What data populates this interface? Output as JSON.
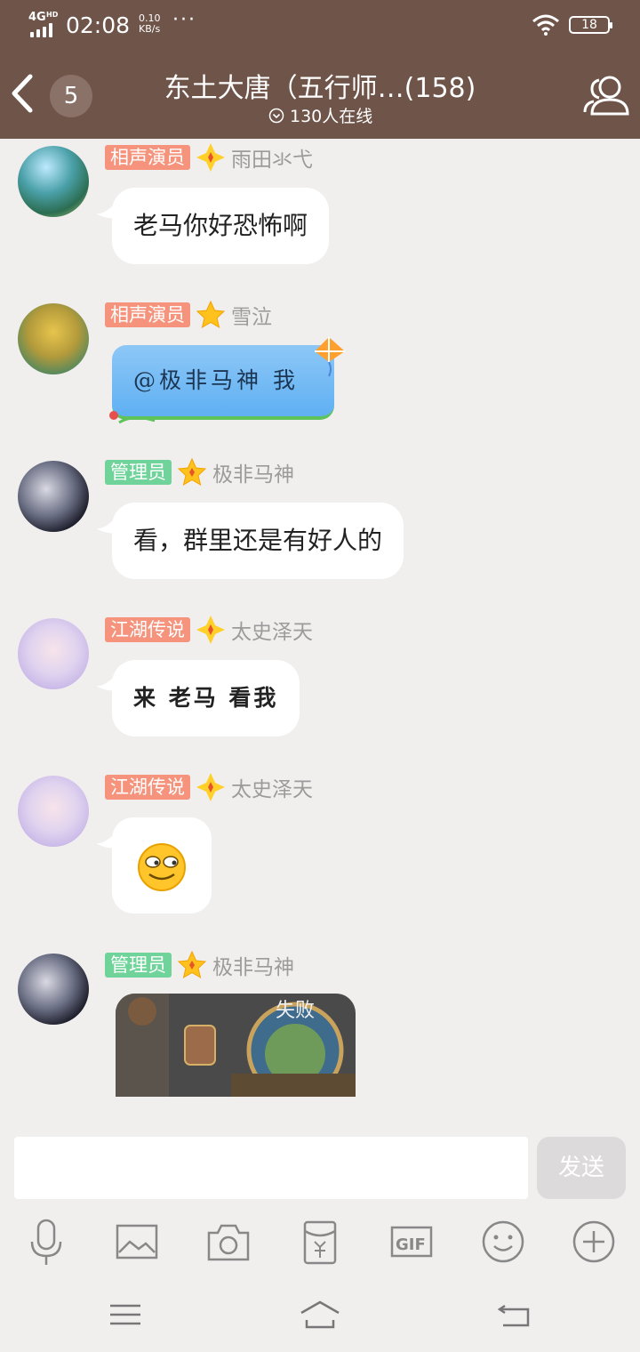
{
  "status_bar": {
    "network": "4G",
    "network_sup": "HD",
    "time": "02:08",
    "speed_value": "0.10",
    "speed_unit": "KB/s",
    "more": "···",
    "battery": "18"
  },
  "header": {
    "unread_count": "5",
    "title": "东土大唐（五行师…(158)",
    "online": "130人在线",
    "icons": [
      "back-arrow-icon",
      "chevron-circle-icon",
      "members-icon"
    ]
  },
  "messages": [
    {
      "tag": "相声演员",
      "tag_color": "#f5937d",
      "rank_icon": "diamond-star-icon",
      "user": "雨田氺弋",
      "text": "老马你好恐怖啊",
      "type": "text"
    },
    {
      "tag": "相声演员",
      "tag_color": "#f5937d",
      "rank_icon": "star-icon",
      "user": "雪泣",
      "text": "@极非马神 我",
      "type": "kite-bubble"
    },
    {
      "tag": "管理员",
      "tag_color": "#6fd39a",
      "rank_icon": "star-icon",
      "user": "极非马神",
      "text": "看，群里还是有好人的",
      "type": "text"
    },
    {
      "tag": "江湖传说",
      "tag_color": "#f5937d",
      "rank_icon": "diamond-star-icon",
      "user": "太史泽天",
      "text": "来 老马 看我",
      "type": "bold-text"
    },
    {
      "tag": "江湖传说",
      "tag_color": "#f5937d",
      "rank_icon": "diamond-star-icon",
      "user": "太史泽天",
      "text": "",
      "type": "emoji",
      "emoji": "smirk-face-icon"
    },
    {
      "tag": "管理员",
      "tag_color": "#6fd39a",
      "rank_icon": "star-icon",
      "user": "极非马神",
      "text": "",
      "type": "image"
    }
  ],
  "input": {
    "placeholder": "",
    "send_label": "发送",
    "tools": [
      "microphone-icon",
      "image-icon",
      "camera-icon",
      "red-packet-icon",
      "gif-icon",
      "emoji-icon",
      "plus-icon"
    ]
  },
  "nav": [
    "menu-icon",
    "home-icon",
    "back-icon"
  ],
  "colors": {
    "header_bg": "#6f5449",
    "chat_bg": "#f1eeee",
    "admin_tag": "#6fd39a",
    "title_tag": "#f5937d"
  }
}
